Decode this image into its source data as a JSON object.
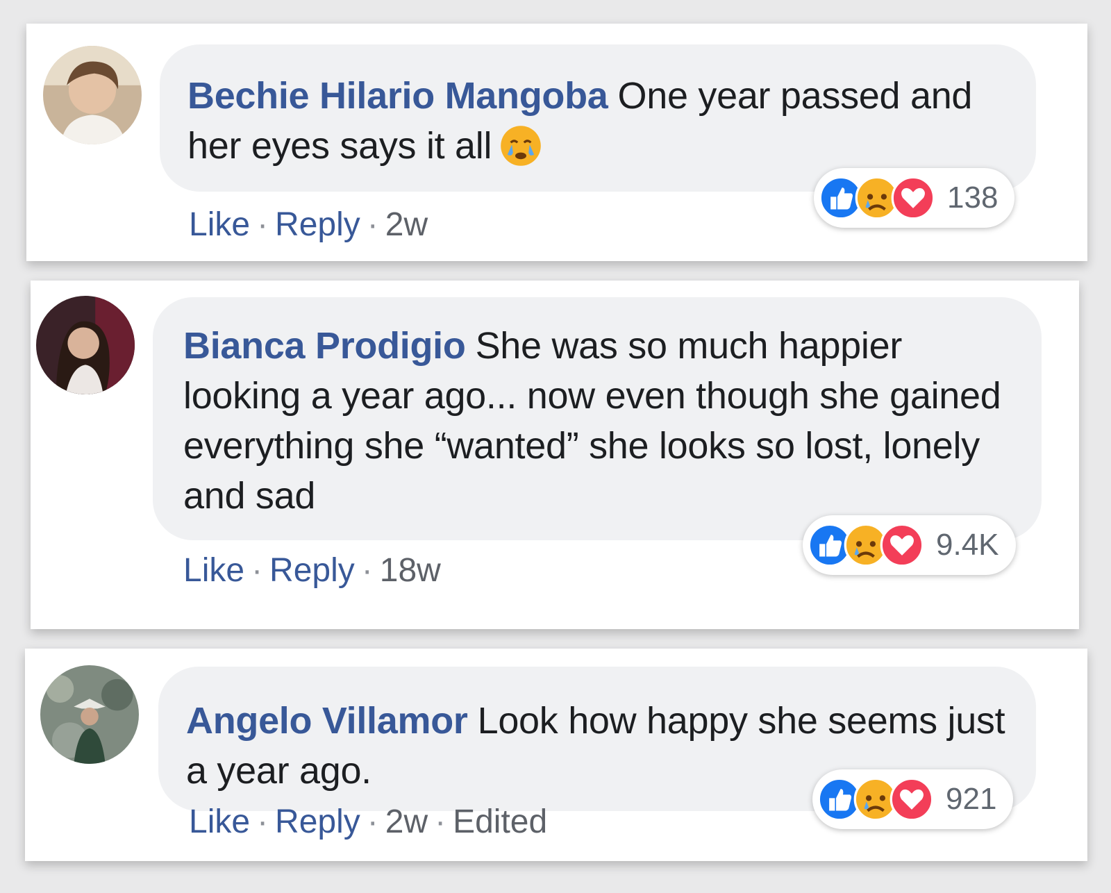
{
  "comments": [
    {
      "author": "Bechie Hilario Mangoba",
      "text": "One year passed and her eyes says it all",
      "emoji": "crying-face",
      "actions": {
        "like": "Like",
        "reply": "Reply",
        "time": "2w",
        "edited": ""
      },
      "reactions": {
        "icons": [
          "like-icon",
          "sad-icon",
          "love-icon"
        ],
        "count": "138"
      }
    },
    {
      "author": "Bianca Prodigio",
      "text": "She was so much happier looking a year ago... now even though she gained everything she “wanted” she looks so lost, lonely and sad",
      "emoji": "",
      "actions": {
        "like": "Like",
        "reply": "Reply",
        "time": "18w",
        "edited": ""
      },
      "reactions": {
        "icons": [
          "like-icon",
          "sad-icon",
          "love-icon"
        ],
        "count": "9.4K"
      }
    },
    {
      "author": "Angelo Villamor",
      "text": "Look how happy she seems just a year ago.",
      "emoji": "",
      "actions": {
        "like": "Like",
        "reply": "Reply",
        "time": "2w",
        "edited": "Edited"
      },
      "reactions": {
        "icons": [
          "like-icon",
          "sad-icon",
          "love-icon"
        ],
        "count": "921"
      }
    }
  ],
  "separator": "·",
  "colors": {
    "author": "#385898",
    "bubble": "#f0f1f3",
    "like": "#1877f2",
    "love": "#f33e58",
    "sad": "#f7b125"
  }
}
